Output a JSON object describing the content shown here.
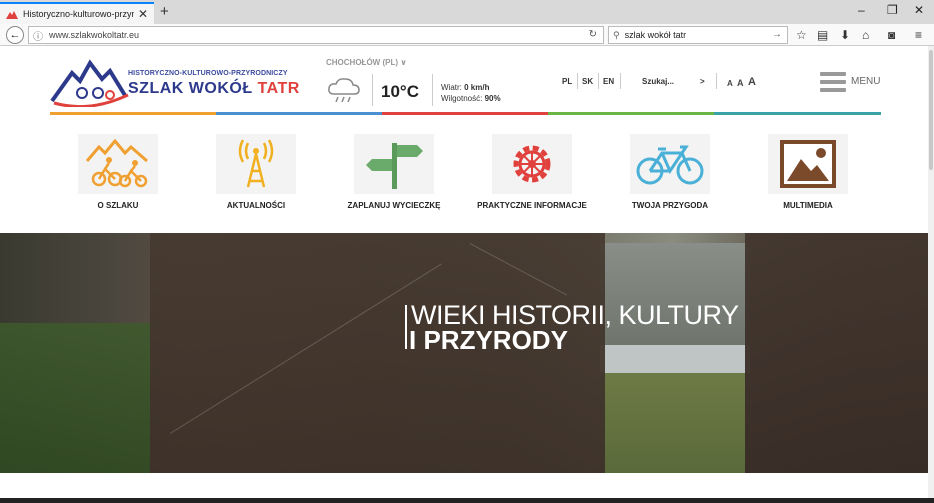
{
  "browser": {
    "tab_title": "Historyczno-kulturowo-przyrodniczy",
    "new_tab": "+",
    "url": "www.szlakwokoltatr.eu",
    "search_query": "szlak wokół tatr",
    "window_controls": {
      "minimize": "–",
      "restore": "❐",
      "close": "✕"
    }
  },
  "header": {
    "logo_top": "HISTORYCZNO-KULTUROWO-PRZYRODNICZY",
    "logo_main_a": "SZLAK WOKÓŁ ",
    "logo_main_b": "TATR",
    "weather_location": "CHOCHOŁÓW (PL) ∨",
    "temperature": "10°C",
    "wind_label": "Wiatr: ",
    "wind_value": "0 km/h",
    "humidity_label": "Wilgotność: ",
    "humidity_value": "90%",
    "languages": [
      "PL",
      "SK",
      "EN"
    ],
    "search_label": "Szukaj...",
    "search_arrow": ">",
    "font_sizes": [
      "A",
      "A",
      "A"
    ],
    "menu_label": "MENU"
  },
  "categories": [
    {
      "label": "O SZLAKU",
      "icon": "cyclists-mountain-icon"
    },
    {
      "label": "AKTUALNOŚCI",
      "icon": "radio-tower-icon"
    },
    {
      "label": "ZAPLANUJ WYCIECZKĘ",
      "icon": "signpost-icon"
    },
    {
      "label": "PRAKTYCZNE INFORMACJE",
      "icon": "gear-icon"
    },
    {
      "label": "TWOJA PRZYGODA",
      "icon": "bicycle-icon"
    },
    {
      "label": "MULTIMEDIA",
      "icon": "picture-icon"
    }
  ],
  "hero": {
    "line1": "WIEKI HISTORII, KULTURY",
    "line2": "I PRZYRODY"
  },
  "colors": {
    "orange": "#f0a030",
    "blue": "#4a8fd0",
    "red": "#e0413c",
    "green": "#6bb544",
    "teal": "#3aa3a8"
  }
}
